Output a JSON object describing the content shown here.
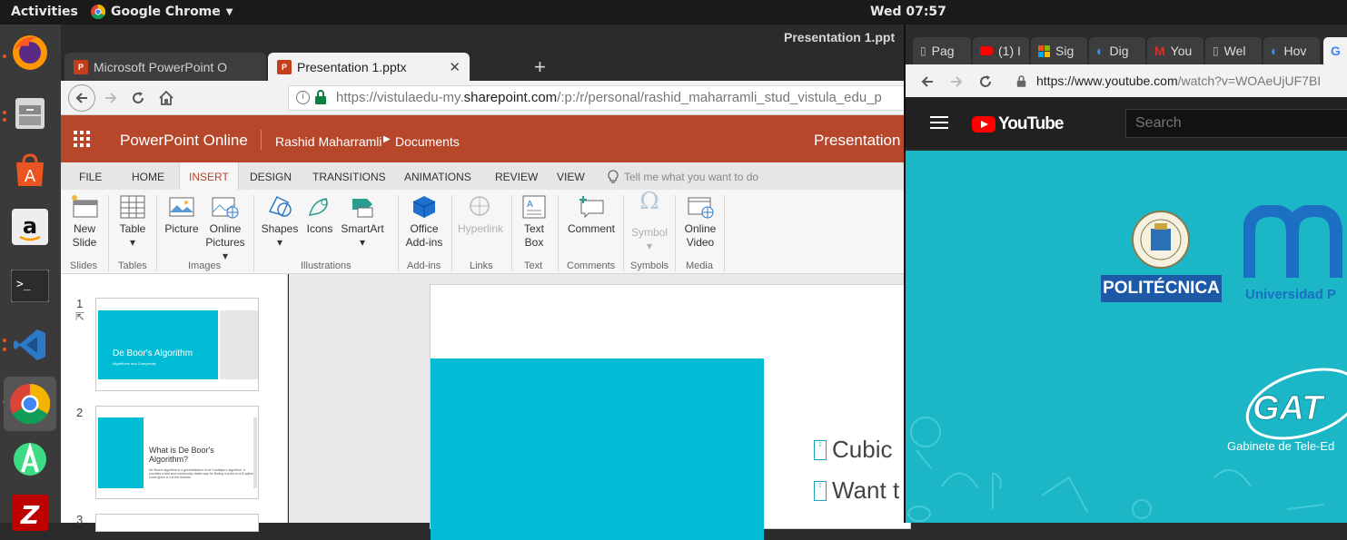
{
  "topbar": {
    "activities": "Activities",
    "app": "Google Chrome",
    "clock": "Wed 07:57"
  },
  "dock": {
    "items": [
      "firefox-icon",
      "files-icon",
      "software-icon",
      "amazon-icon",
      "terminal-icon",
      "vscode-icon",
      "chrome-icon",
      "android-studio-icon",
      "filezilla-icon"
    ]
  },
  "chrome": {
    "window_title": "Presentation 1.ppt",
    "tabs": [
      {
        "label": "Microsoft PowerPoint O"
      },
      {
        "label": "Presentation 1.pptx"
      }
    ],
    "new_tab": "+",
    "url_domain": "https://vistulaedu-my.",
    "url_host": "sharepoint.com",
    "url_path": "/:p:/r/personal/rashid_maharramli_stud_vistula_edu_p"
  },
  "ppt": {
    "app_name": "PowerPoint Online",
    "user": "Rashid Maharramli",
    "folder": "Documents",
    "file_title": "Presentation",
    "ribbon_tabs": [
      "FILE",
      "HOME",
      "INSERT",
      "DESIGN",
      "TRANSITIONS",
      "ANIMATIONS",
      "REVIEW",
      "VIEW"
    ],
    "tell_me": "Tell me what you want to do",
    "commands": {
      "new_slide": [
        "New",
        "Slide"
      ],
      "table": [
        "Table",
        "▾"
      ],
      "picture": "Picture",
      "online_pictures": [
        "Online",
        "Pictures ▾"
      ],
      "shapes": [
        "Shapes",
        "▾"
      ],
      "icons": "Icons",
      "smartart": [
        "SmartArt",
        "▾"
      ],
      "office_addins": [
        "Office",
        "Add-ins"
      ],
      "hyperlink": "Hyperlink",
      "text_box": [
        "Text",
        "Box"
      ],
      "comment": "Comment",
      "symbol": [
        "Symbol",
        "▾"
      ],
      "online_video": [
        "Online",
        "Video"
      ]
    },
    "groups": [
      "Slides",
      "Tables",
      "Images",
      "Illustrations",
      "Add-ins",
      "Links",
      "Text",
      "Comments",
      "Symbols",
      "Media"
    ],
    "slides": [
      {
        "num": "1",
        "title": "De Boor's Algorithm",
        "subtitle": "Algorithms and Complexity"
      },
      {
        "num": "2",
        "title": "What is De Boor's Algorithm?",
        "body": "De Boor's algorithm is a generalization of de Casteljau's algorithm. It provides a fast and numerically stable way for finding a point on a B-spline curve given a u in the domain."
      },
      {
        "num": "3"
      }
    ],
    "bullets": [
      "Cubic",
      "Want t"
    ]
  },
  "right_window": {
    "tabs": [
      "Pag",
      "(1) I",
      "Sig",
      "Dig",
      "You",
      "Wel",
      "Hov"
    ],
    "url_domain": "https://www.youtube.com",
    "url_path": "/watch?v=WOAeUjUF7BI",
    "yt_logo": "YouTube",
    "search_placeholder": "Search",
    "video": {
      "upm_label": "POLITÉCNICA",
      "um_label": "Universidad P",
      "gat_label": "Gabinete de Tele-Ed"
    }
  },
  "colors": {
    "ppt_brand": "#b7472a",
    "slide_accent": "#00bcd4",
    "yt_bg": "#1bb7c7"
  }
}
